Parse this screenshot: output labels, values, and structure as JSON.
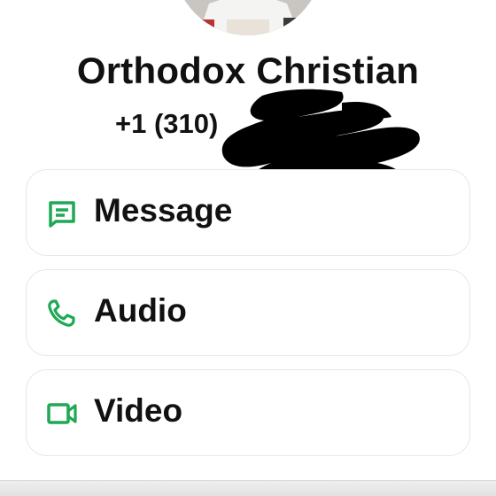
{
  "contact": {
    "name": "Orthodox Christian",
    "phone_visible": "+1 (310)"
  },
  "actions": [
    {
      "label": "Message",
      "icon": "message-icon"
    },
    {
      "label": "Audio",
      "icon": "phone-icon"
    },
    {
      "label": "Video",
      "icon": "video-camera-icon"
    }
  ],
  "colors": {
    "accent_green": "#1fa855",
    "text": "#111111",
    "card_border": "#e7e7e9",
    "background": "#ffffff"
  }
}
